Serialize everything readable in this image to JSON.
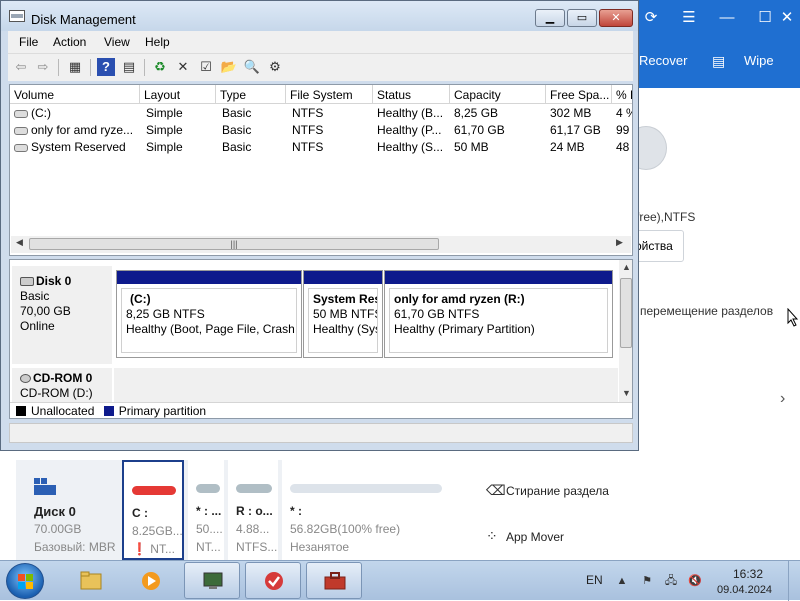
{
  "background_app": {
    "toolbar": {
      "recover_label": "Recover",
      "wipe_label": "Wipe"
    },
    "partition_fs_text": "free),NTFS",
    "properties_button": "ойства",
    "move_partition_text": "перемещение разделов",
    "disk_map": {
      "disk": {
        "name": "Диск 0",
        "size": "70.00GB",
        "type": "Базовый: MBR"
      },
      "partitions": [
        {
          "label": "C :",
          "size": "8.25GB...",
          "fs": "NT...",
          "color": "#e53935"
        },
        {
          "label": "* : ...",
          "size": "50....",
          "fs": "NT...",
          "color": "#b0bec5"
        },
        {
          "label": "R : o...",
          "size": "4.88...",
          "fs": "NTFS...",
          "color": "#b0bec5"
        },
        {
          "label": "* :",
          "size": "56.82GB(100% free)",
          "fs": "Незанятое",
          "color": "#dde3ea"
        }
      ]
    },
    "right_list": [
      {
        "icon": "eraser-icon",
        "label": "Стирание раздела"
      },
      {
        "icon": "app-mover-icon",
        "label": "App Mover"
      }
    ]
  },
  "window": {
    "title": "Disk Management",
    "menu": [
      "File",
      "Action",
      "View",
      "Help"
    ],
    "columns": [
      "Volume",
      "Layout",
      "Type",
      "File System",
      "Status",
      "Capacity",
      "Free Spa...",
      "% F"
    ],
    "volumes": [
      [
        "(C:)",
        "Simple",
        "Basic",
        "NTFS",
        "Healthy (B...",
        "8,25 GB",
        "302 MB",
        "4 %"
      ],
      [
        "only for amd ryze...",
        "Simple",
        "Basic",
        "NTFS",
        "Healthy (P...",
        "61,70 GB",
        "61,17 GB",
        "99"
      ],
      [
        "System Reserved",
        "Simple",
        "Basic",
        "NTFS",
        "Healthy (S...",
        "50 MB",
        "24 MB",
        "48"
      ]
    ],
    "disk0": {
      "name": "Disk 0",
      "type": "Basic",
      "size": "70,00 GB",
      "status": "Online"
    },
    "partitions": [
      {
        "name": "(C:)",
        "size": "8,25 GB NTFS",
        "status": "Healthy (Boot, Page File, Crash D"
      },
      {
        "name": "System Res",
        "size": "50 MB NTFS",
        "status": "Healthy (Sys"
      },
      {
        "name": "only for amd ryzen  (R:)",
        "size": "61,70 GB NTFS",
        "status": "Healthy (Primary Partition)"
      }
    ],
    "cdrom": {
      "name": "CD-ROM 0",
      "drive": "CD-ROM (D:)"
    },
    "legend": {
      "unallocated": "Unallocated",
      "primary": "Primary partition",
      "unallocated_color": "#000000",
      "primary_color": "#0e1a8c"
    }
  },
  "taskbar": {
    "language": "EN",
    "time": "16:32",
    "date": "09.04.2024"
  }
}
